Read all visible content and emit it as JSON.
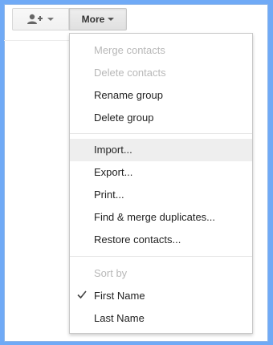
{
  "colors": {
    "background": "#70aaf6",
    "disabled_text": "#b8b8b8",
    "hover": "#eeeeee"
  },
  "toolbar": {
    "add_contact_icon": "add-person-icon",
    "more_label": "More"
  },
  "menu": {
    "merge_contacts": "Merge contacts",
    "delete_contacts": "Delete contacts",
    "rename_group": "Rename group",
    "delete_group": "Delete group",
    "import": "Import...",
    "export": "Export...",
    "print": "Print...",
    "find_merge": "Find & merge duplicates...",
    "restore": "Restore contacts...",
    "sort_by": "Sort by",
    "first_name": "First Name",
    "last_name": "Last Name",
    "selected_sort": "First Name"
  }
}
